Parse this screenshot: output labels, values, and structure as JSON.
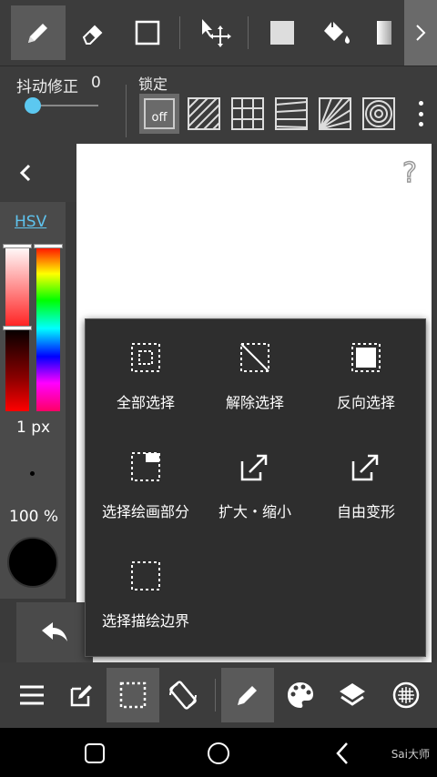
{
  "toolbar": {
    "tools": [
      "pen-tool",
      "eraser-tool",
      "shape-tool",
      "move-tool",
      "fill-color",
      "bucket-tool",
      "gradient-tool"
    ],
    "active": "pen-tool"
  },
  "stabilizer": {
    "label": "抖动修正",
    "value": "0",
    "level": 0
  },
  "lock": {
    "label": "锁定",
    "off_label": "off",
    "modes": [
      "off",
      "parallel-lines",
      "grid",
      "perspective-lines",
      "radial",
      "concentric"
    ]
  },
  "color_panel": {
    "mode_label": "HSV",
    "brush_size": "1 px",
    "opacity": "100 %",
    "current_color": "#000000",
    "accent": "#5fc3ee"
  },
  "selection_menu": {
    "items": [
      {
        "label": "全部选择",
        "icon": "select-all-icon"
      },
      {
        "label": "解除选择",
        "icon": "deselect-icon"
      },
      {
        "label": "反向选择",
        "icon": "invert-selection-icon"
      },
      {
        "label": "选择绘画部分",
        "icon": "select-drawn-icon"
      },
      {
        "label": "扩大・缩小",
        "icon": "expand-shrink-icon"
      },
      {
        "label": "自由变形",
        "icon": "free-transform-icon"
      },
      {
        "label": "选择描绘边界",
        "icon": "select-border-icon"
      }
    ]
  },
  "bottom_bar": {
    "buttons": [
      "menu-icon",
      "edit-icon",
      "selection-icon",
      "rotate-icon",
      "pen-icon",
      "palette-icon",
      "layers-icon",
      "material-icon"
    ],
    "active": [
      "selection-icon",
      "pen-icon"
    ]
  },
  "system_nav": [
    "recent-apps",
    "home",
    "back"
  ],
  "watermark": "Sai大师"
}
